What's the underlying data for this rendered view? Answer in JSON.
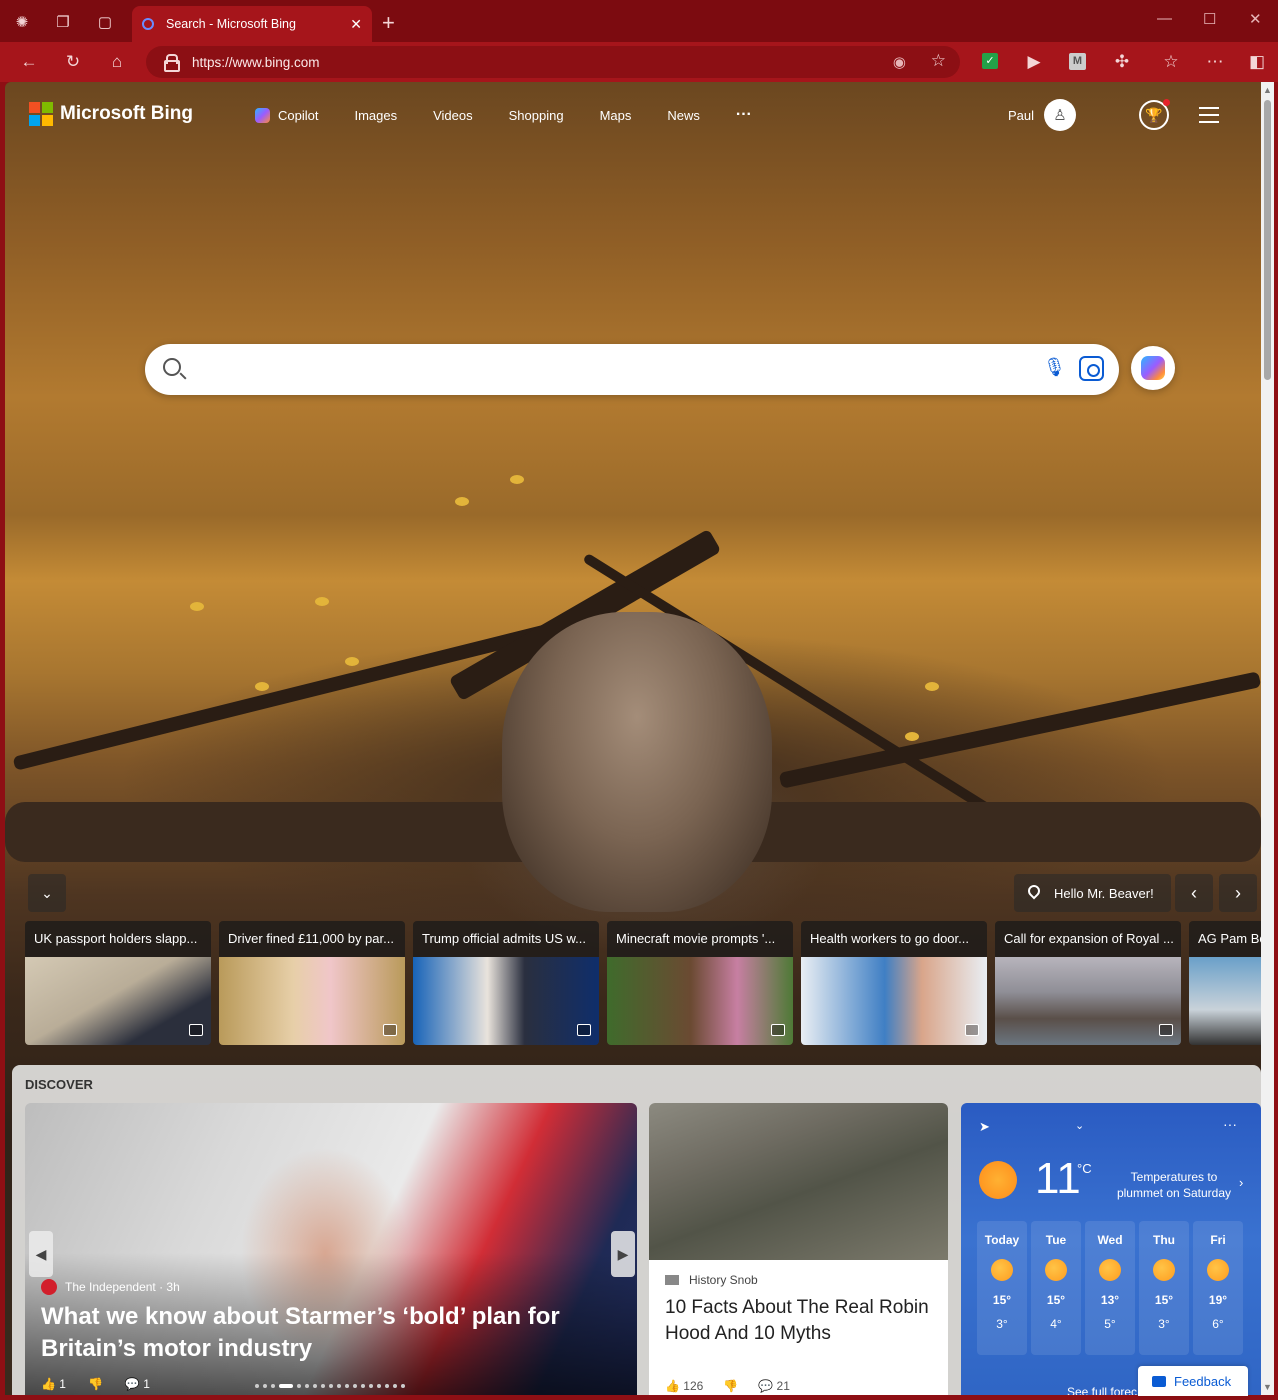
{
  "browser": {
    "tab_title": "Search - Microsoft Bing",
    "url": "https://www.bing.com",
    "new_tab_glyph": "+",
    "accent": "#a6151b"
  },
  "bing": {
    "logo_text": "Microsoft Bing",
    "nav": [
      "Copilot",
      "Images",
      "Videos",
      "Shopping",
      "Maps",
      "News"
    ],
    "nav_more": "···",
    "user_name": "Paul",
    "search_placeholder": ""
  },
  "image": {
    "caption": "Hello Mr. Beaver!"
  },
  "news": [
    {
      "title": "UK passport holders slapp...",
      "colors": [
        "#d4c9b4",
        "#2b2f3c"
      ]
    },
    {
      "title": "Driver fined £11,000 by par...",
      "colors": [
        "#b99a5a",
        "#e7cfa8"
      ]
    },
    {
      "title": "Trump official admits US w...",
      "colors": [
        "#1763b8",
        "#0f2e6b"
      ]
    },
    {
      "title": "Minecraft movie prompts '...",
      "colors": [
        "#3f6b2c",
        "#c77fa2"
      ]
    },
    {
      "title": "Health workers to go door...",
      "colors": [
        "#e9eef3",
        "#3f7fc4"
      ]
    },
    {
      "title": "Call for expansion of Royal ...",
      "colors": [
        "#8f8e96",
        "#5a4f49"
      ]
    },
    {
      "title": "AG Pam Bo",
      "colors": [
        "#6aa0c9",
        "#c9d2d9"
      ]
    }
  ],
  "discover": {
    "label": "DISCOVER",
    "hero": {
      "source": "The Independent · 3h",
      "headline": "What we know about Starmer’s ‘bold’ plan for Britain’s motor industry",
      "likes": "1",
      "comments": "1"
    },
    "article": {
      "source": "History Snob",
      "headline": "10 Facts About The Real Robin Hood And 10 Myths",
      "likes": "126",
      "comments": "21"
    },
    "weather": {
      "temp": "11",
      "unit": "°C",
      "note": "Temperatures to plummet on Saturday",
      "forecast": [
        {
          "day": "Today",
          "hi": "15°",
          "lo": "3°"
        },
        {
          "day": "Tue",
          "hi": "15°",
          "lo": "4°"
        },
        {
          "day": "Wed",
          "hi": "13°",
          "lo": "5°"
        },
        {
          "day": "Thu",
          "hi": "15°",
          "lo": "3°"
        },
        {
          "day": "Fri",
          "hi": "19°",
          "lo": "6°"
        }
      ],
      "see_full": "See full forec"
    }
  },
  "feedback": "Feedback"
}
